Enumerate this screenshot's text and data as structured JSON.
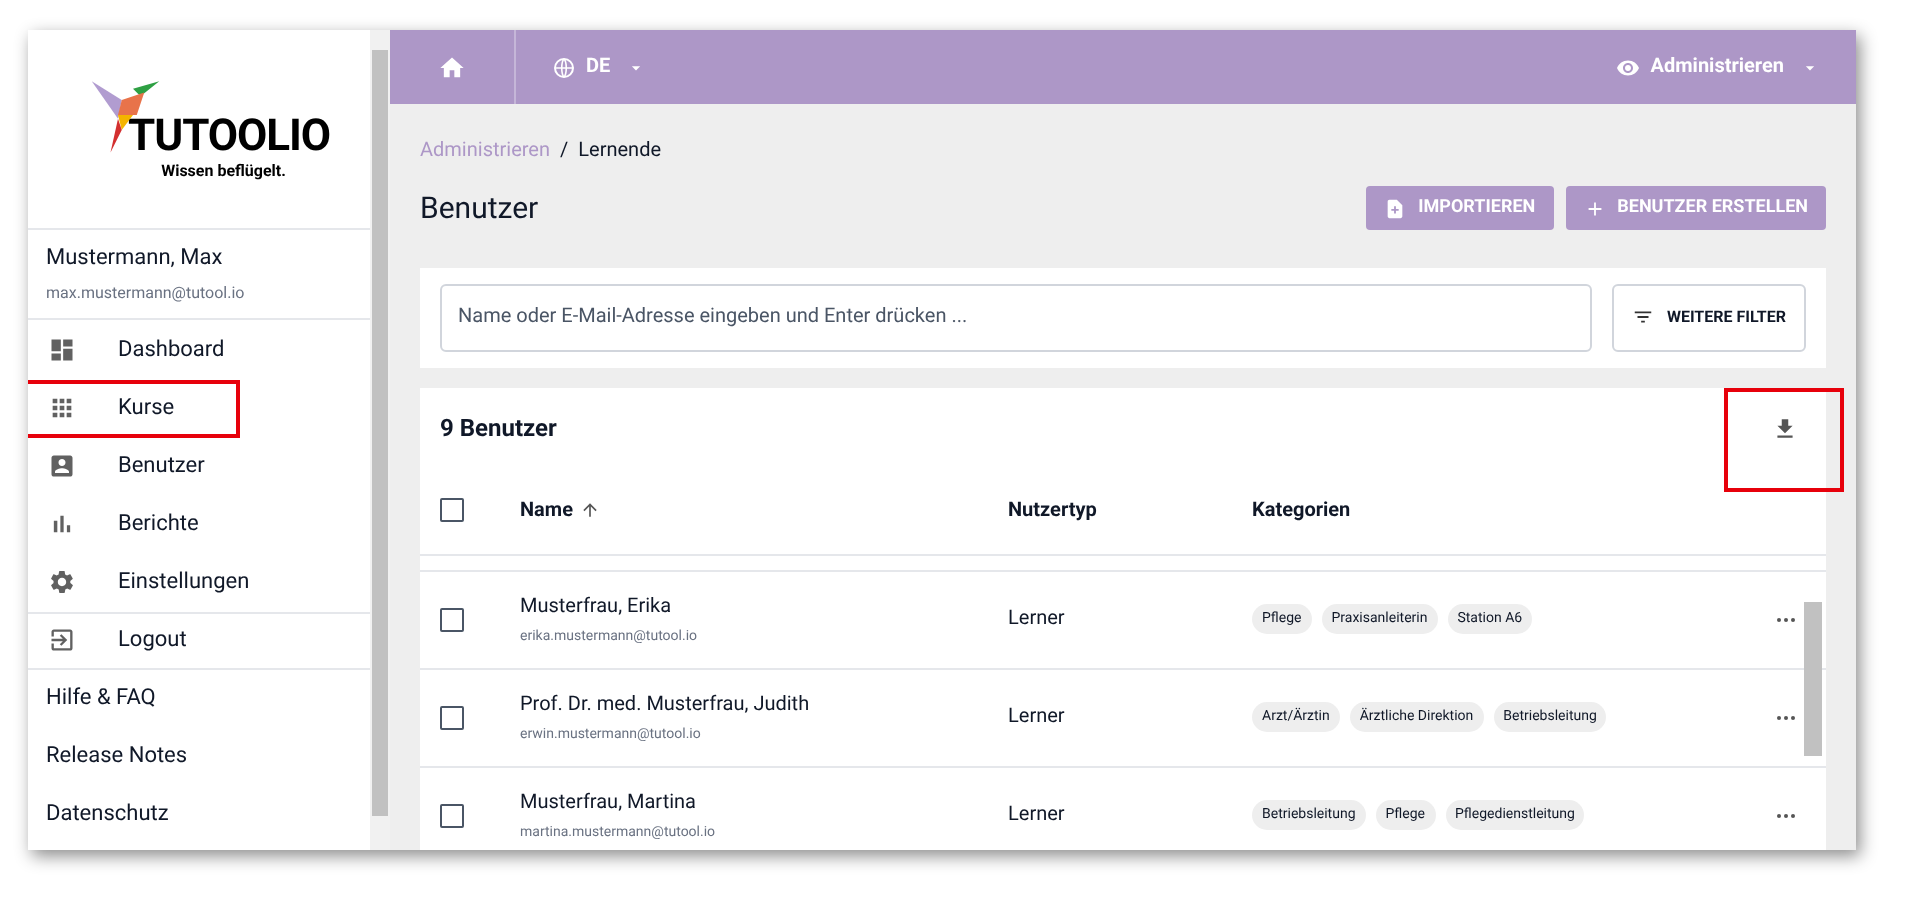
{
  "sidebar": {
    "logo": {
      "wordmark": "TUTOOLIO",
      "tagline": "Wissen beflügelt."
    },
    "user": {
      "name": "Mustermann, Max",
      "email": "max.mustermann@tutool.io"
    },
    "nav": [
      {
        "label": "Dashboard",
        "kind": "dashboard",
        "highlighted": false
      },
      {
        "label": "Kurse",
        "kind": "apps",
        "highlighted": true
      },
      {
        "label": "Benutzer",
        "kind": "person",
        "highlighted": false
      },
      {
        "label": "Berichte",
        "kind": "bars",
        "highlighted": false
      },
      {
        "label": "Einstellungen",
        "kind": "gear",
        "highlighted": false
      }
    ],
    "logout": "Logout",
    "links": [
      "Hilfe & FAQ",
      "Release Notes",
      "Datenschutz"
    ]
  },
  "topbar": {
    "language": "DE",
    "mode": "Administrieren"
  },
  "breadcrumb": [
    "Administrieren",
    "Lernende"
  ],
  "breadcrumb_separator": "/",
  "page_title": "Benutzer",
  "actions": [
    "IMPORTIEREN",
    "BENUTZER ERSTELLEN"
  ],
  "search": {
    "placeholder": "Name oder E-Mail-Adresse eingeben und Enter drücken ..."
  },
  "filter_button": "WEITERE FILTER",
  "table": {
    "count": "9 Benutzer",
    "download_highlighted": true,
    "select_all_checked": false,
    "columns": [
      "Name",
      "Nutzertyp",
      "Kategorien"
    ],
    "rows": [
      {
        "checked": false,
        "name": "Musterfrau, Erika",
        "email": "erika.mustermann@tutool.io",
        "type": "Lerner",
        "tags": [
          "Pflege",
          "Praxisanleiterin",
          "Station A6"
        ]
      },
      {
        "checked": false,
        "name": "Prof. Dr. med. Musterfrau, Judith",
        "email": "erwin.mustermann@tutool.io",
        "type": "Lerner",
        "tags": [
          "Arzt/Ärztin",
          "Ärztliche Direktion",
          "Betriebsleitung"
        ]
      },
      {
        "checked": false,
        "name": "Musterfrau, Martina",
        "email": "martina.mustermann@tutool.io",
        "type": "Lerner",
        "tags": [
          "Betriebsleitung",
          "Pflege",
          "Pflegedienstleitung"
        ]
      }
    ]
  }
}
